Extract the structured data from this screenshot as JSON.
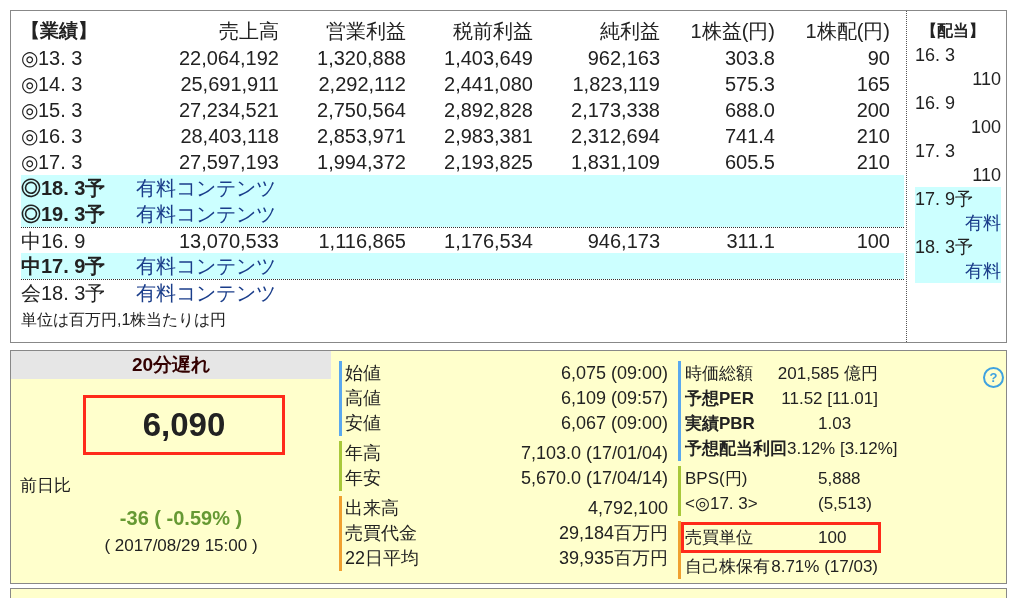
{
  "results": {
    "title": "【業績】",
    "columns": [
      "売上高",
      "営業利益",
      "税前利益",
      "純利益",
      "1株益(円)",
      "1株配(円)"
    ],
    "rows": [
      {
        "kind": "data",
        "label": "◎13. 3",
        "highlighted": false,
        "divider_above": false,
        "values": [
          "22,064,192",
          "1,320,888",
          "1,403,649",
          "962,163",
          "303.8",
          "90"
        ]
      },
      {
        "kind": "data",
        "label": "◎14. 3",
        "highlighted": false,
        "divider_above": false,
        "values": [
          "25,691,911",
          "2,292,112",
          "2,441,080",
          "1,823,119",
          "575.3",
          "165"
        ]
      },
      {
        "kind": "data",
        "label": "◎15. 3",
        "highlighted": false,
        "divider_above": false,
        "values": [
          "27,234,521",
          "2,750,564",
          "2,892,828",
          "2,173,338",
          "688.0",
          "200"
        ]
      },
      {
        "kind": "data",
        "label": "◎16. 3",
        "highlighted": false,
        "divider_above": false,
        "values": [
          "28,403,118",
          "2,853,971",
          "2,983,381",
          "2,312,694",
          "741.4",
          "210"
        ]
      },
      {
        "kind": "data",
        "label": "◎17. 3",
        "highlighted": false,
        "divider_above": false,
        "values": [
          "27,597,193",
          "1,994,372",
          "2,193,825",
          "1,831,109",
          "605.5",
          "210"
        ]
      },
      {
        "kind": "paid",
        "label": "◎18. 3予",
        "highlighted": true,
        "divider_above": false,
        "link": "有料コンテンツ"
      },
      {
        "kind": "paid",
        "label": "◎19. 3予",
        "highlighted": true,
        "divider_above": false,
        "link": "有料コンテンツ"
      },
      {
        "kind": "data",
        "label": "中16. 9",
        "highlighted": false,
        "divider_above": true,
        "values": [
          "13,070,533",
          "1,116,865",
          "1,176,534",
          "946,173",
          "311.1",
          "100"
        ]
      },
      {
        "kind": "paid",
        "label": "中17. 9予",
        "highlighted": true,
        "divider_above": false,
        "link": "有料コンテンツ"
      },
      {
        "kind": "paid",
        "label": "会18. 3予",
        "highlighted": false,
        "divider_above": true,
        "link": "有料コンテンツ"
      }
    ],
    "note": "単位は百万円,1株当たりは円"
  },
  "dividends": {
    "title": "【配当】",
    "items": [
      {
        "period": "16. 3",
        "value": "110",
        "paid": false,
        "highlighted": false
      },
      {
        "period": "16. 9",
        "value": "100",
        "paid": false,
        "highlighted": false
      },
      {
        "period": "17. 3",
        "value": "110",
        "paid": false,
        "highlighted": false
      },
      {
        "period": "17. 9予",
        "value": "有料",
        "paid": true,
        "highlighted": true
      },
      {
        "period": "18. 3予",
        "value": "有料",
        "paid": true,
        "highlighted": true
      }
    ]
  },
  "quote": {
    "delay": "20分遅れ",
    "price": "6,090",
    "price_highlighted": true,
    "change_label": "前日比",
    "change": "-36 ( -0.59% )",
    "timestamp": "( 2017/08/29 15:00 )"
  },
  "prices": [
    {
      "color": "#5aa8ee",
      "rows": [
        {
          "label": "始値",
          "value": "6,075 (09:00)"
        },
        {
          "label": "高値",
          "value": "6,109 (09:57)"
        },
        {
          "label": "安値",
          "value": "6,067 (09:00)"
        }
      ]
    },
    {
      "color": "#a8c83a",
      "rows": [
        {
          "label": "年高",
          "value": "7,103.0 (17/01/04)"
        },
        {
          "label": "年安",
          "value": "5,670.0 (17/04/14)"
        }
      ]
    },
    {
      "color": "#f0a030",
      "rows": [
        {
          "label": "出来高",
          "value": "4,792,100"
        },
        {
          "label": "売買代金",
          "value": "29,184百万円"
        },
        {
          "label": "22日平均",
          "value": "39,935百万円"
        }
      ]
    }
  ],
  "indicators": {
    "help": "?",
    "groups": [
      {
        "color": "#5aa8ee",
        "rows": [
          {
            "label": "時価総額",
            "value": "201,585 億円",
            "bold": false,
            "highlighted": false
          },
          {
            "label": "予想PER",
            "value": "11.52 [11.01]",
            "bold": true,
            "highlighted": false
          },
          {
            "label": "実績PBR",
            "value": "1.03",
            "bold": true,
            "highlighted": false
          },
          {
            "label": "予想配当利回",
            "value": "3.12% [3.12%]",
            "bold": true,
            "highlighted": false
          }
        ]
      },
      {
        "color": "#a8c83a",
        "rows": [
          {
            "label": "BPS(円)",
            "value": "5,888",
            "bold": false,
            "highlighted": false
          },
          {
            "label": "<◎17. 3>",
            "value": "(5,513)",
            "bold": false,
            "highlighted": false
          }
        ]
      },
      {
        "color": "#f0a030",
        "rows": [
          {
            "label": "売買単位",
            "value": "100",
            "bold": false,
            "highlighted": true
          },
          {
            "label": "自己株保有",
            "value": "8.71% (17/03)",
            "bold": false,
            "highlighted": false
          }
        ]
      }
    ]
  }
}
